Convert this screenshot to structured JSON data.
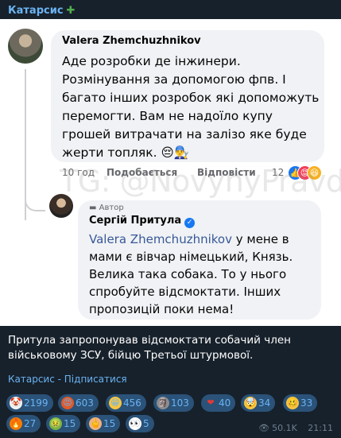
{
  "channel": {
    "name": "Катарсис",
    "plus": "✚"
  },
  "post": {
    "comment1": {
      "author": "Valera Zhemchuzhnikov",
      "text": "Аде розробки де інжинери. Розмінування за допомогою фпв. І багато інших розробок які допоможуть перемогти. Вам не надоїло купу грошей витрачати на залізо яке буде жерти топляк. 😔👨‍🔧",
      "time": "10 год",
      "like": "Подобається",
      "reply": "Відповісти",
      "reactions_count": "12"
    },
    "watermark": "TG: @NovynyPravdy",
    "comment2": {
      "badge": "Автор",
      "author": "Сергій Притула",
      "mention": "Valera Zhemchuzhnikov",
      "text": " у мене в мами є вівчар німецький, Князь. Велика така собака. То у нього спробуйте відсмоктати. Інших пропозицій поки нема!"
    },
    "caption": "Притула запропонував відсмоктати собачий член військовому ЗСУ, бійцю Третьої штурмової.",
    "subscribe": "Катарсис - Підписатися"
  },
  "reactions": [
    {
      "icon": "clown-icon",
      "emoji": "🤡",
      "count": "2199"
    },
    {
      "icon": "angry-face-icon",
      "emoji": "😡",
      "count": "603"
    },
    {
      "icon": "grin-icon",
      "emoji": "😁",
      "count": "456"
    },
    {
      "icon": "moai-icon",
      "emoji": "🗿",
      "count": "103"
    },
    {
      "icon": "heart-icon",
      "emoji": "❤",
      "count": "40"
    },
    {
      "icon": "exploding-head-icon",
      "emoji": "🤯",
      "count": "34"
    },
    {
      "icon": "woozy-face-icon",
      "emoji": "🥴",
      "count": "33"
    },
    {
      "icon": "fire-icon",
      "emoji": "🔥",
      "count": "27"
    },
    {
      "icon": "nauseated-face-icon",
      "emoji": "🤢",
      "count": "15"
    },
    {
      "icon": "middle-finger-icon",
      "emoji": "🖕",
      "count": "15"
    },
    {
      "icon": "eyes-icon",
      "emoji": "👀",
      "count": "5"
    }
  ],
  "meta": {
    "views": "50.1K",
    "time": "21:11"
  },
  "colors": {
    "background": "#17212b",
    "accent": "#6ab3f3",
    "chip": "#2b5278"
  }
}
